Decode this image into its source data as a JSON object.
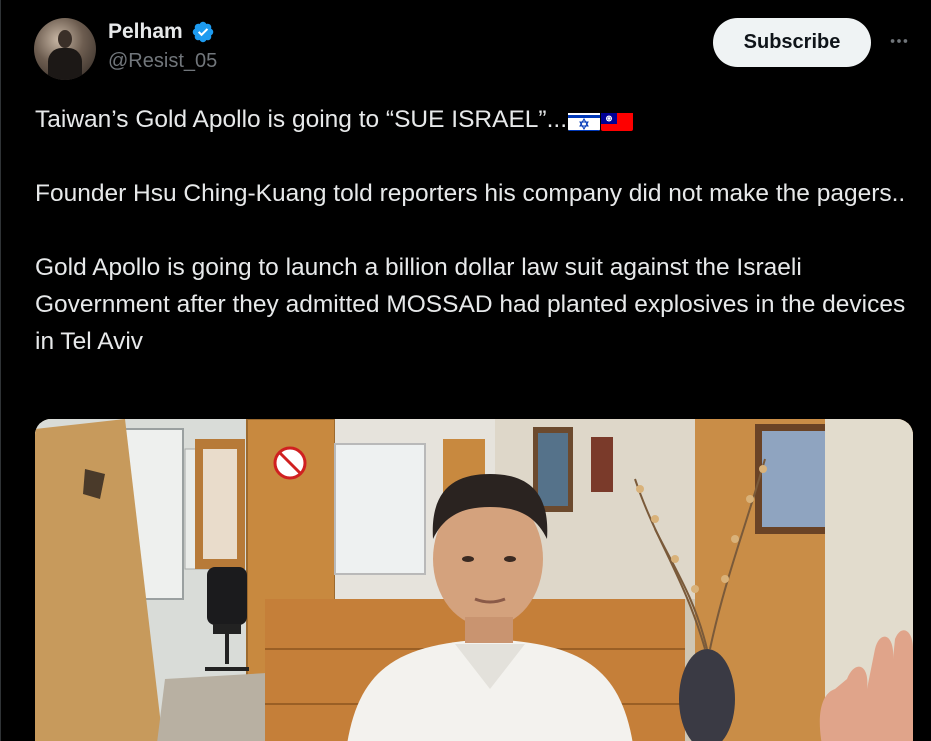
{
  "author": {
    "display_name": "Pelham",
    "handle": "@Resist_05",
    "verified": true
  },
  "actions": {
    "subscribe_label": "Subscribe",
    "more_icon": "more-horizontal-icon"
  },
  "tweet": {
    "line1_text": "Taiwan’s Gold Apollo is going to “SUE ISRAEL”...",
    "flags": [
      "israel-flag",
      "taiwan-flag"
    ],
    "paragraph2": "Founder Hsu Ching-Kuang told reporters his company did not make the pagers..",
    "paragraph3": "Gold Apollo is going to launch a billion dollar law suit against the Israeli Government after they admitted MOSSAD had planted explosives in the devices in Tel Aviv"
  },
  "media": {
    "type": "photo"
  },
  "colors": {
    "background": "#000000",
    "text_primary": "#e7e9ea",
    "text_secondary": "#71767b",
    "verified_blue": "#1d9bf0",
    "subscribe_bg": "#eff3f4"
  }
}
